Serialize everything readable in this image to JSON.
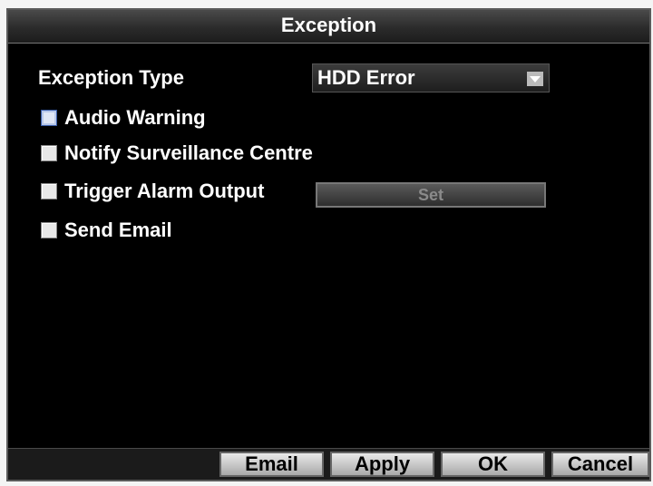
{
  "window": {
    "title": "Exception"
  },
  "exception_type": {
    "label": "Exception Type",
    "selected": "HDD Error"
  },
  "options": [
    {
      "label": "Audio Warning",
      "checked": false
    },
    {
      "label": "Notify Surveillance Centre",
      "checked": false
    },
    {
      "label": "Trigger Alarm Output",
      "checked": false
    },
    {
      "label": "Send Email",
      "checked": false
    }
  ],
  "set_button": {
    "label": "Set"
  },
  "footer": {
    "email_label": "Email",
    "apply_label": "Apply",
    "ok_label": "OK",
    "cancel_label": "Cancel"
  },
  "icons": {
    "dropdown": "chevron-down-icon"
  },
  "colors": {
    "background": "#000000",
    "text": "#ffffff",
    "button": "#d0d0d0"
  }
}
